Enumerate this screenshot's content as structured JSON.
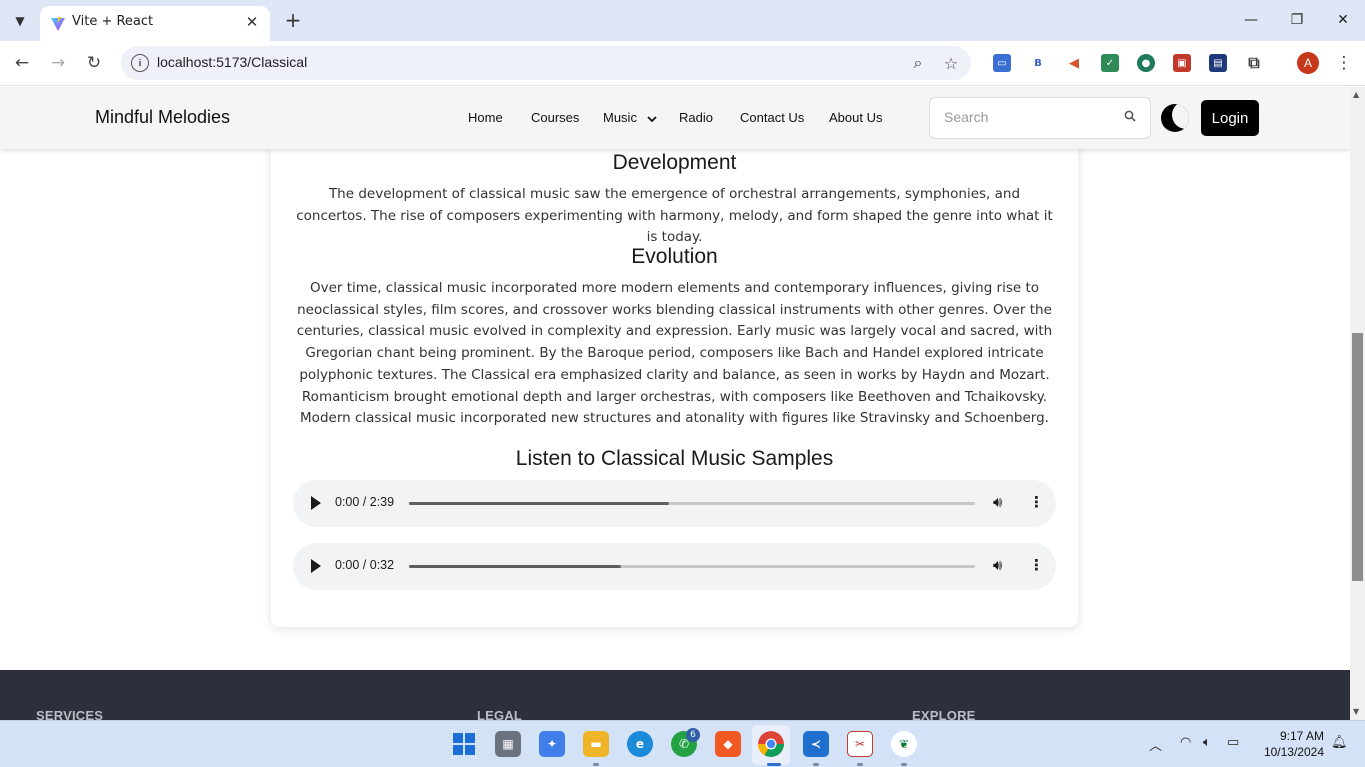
{
  "browser": {
    "tab_title": "Vite + React",
    "url": "localhost:5173/Classical",
    "profile_initial": "A",
    "extensions": [
      {
        "name": "ext-screen",
        "color": "#3b6fd4",
        "glyph": "▭"
      },
      {
        "name": "ext-b",
        "color": "#ffffff",
        "glyph": "B"
      },
      {
        "name": "ext-megaphone",
        "color": "#e0602a",
        "glyph": "📢"
      },
      {
        "name": "ext-check",
        "color": "#2e8b57",
        "glyph": "✓"
      },
      {
        "name": "ext-pin",
        "color": "#1f7a5a",
        "glyph": "●"
      },
      {
        "name": "ext-red",
        "color": "#c0392b",
        "glyph": "▣"
      },
      {
        "name": "ext-blue",
        "color": "#1f3a7a",
        "glyph": "▤"
      }
    ]
  },
  "site": {
    "brand": "Mindful Melodies",
    "nav": {
      "home": "Home",
      "courses": "Courses",
      "music": "Music",
      "radio": "Radio",
      "contact": "Contact Us",
      "about": "About Us"
    },
    "search_placeholder": "Search",
    "login_label": "Login"
  },
  "content": {
    "development_heading": "Development",
    "development_text": "The development of classical music saw the emergence of orchestral arrangements, symphonies, and concertos. The rise of composers experimenting with harmony, melody, and form shaped the genre into what it is today.",
    "evolution_heading": "Evolution",
    "evolution_text": "Over time, classical music incorporated more modern elements and contemporary influences, giving rise to neoclassical styles, film scores, and crossover works blending classical instruments with other genres. Over the centuries, classical music evolved in complexity and expression. Early music was largely vocal and sacred, with Gregorian chant being prominent. By the Baroque period, composers like Bach and Handel explored intricate polyphonic textures. The Classical era emphasized clarity and balance, as seen in works by Haydn and Mozart. Romanticism brought emotional depth and larger orchestras, with composers like Beethoven and Tchaikovsky. Modern classical music incorporated new structures and atonality with figures like Stravinsky and Schoenberg.",
    "samples_heading": "Listen to Classical Music Samples",
    "audio": [
      {
        "time": "0:00 / 2:39",
        "buffered": 0.46
      },
      {
        "time": "0:00 / 0:32",
        "buffered": 0.375
      }
    ]
  },
  "footer": {
    "services": "SERVICES",
    "legal": "LEGAL",
    "explore": "EXPLORE"
  },
  "taskbar": {
    "whatsapp_badge": "6",
    "time": "9:17 AM",
    "date": "10/13/2024"
  }
}
